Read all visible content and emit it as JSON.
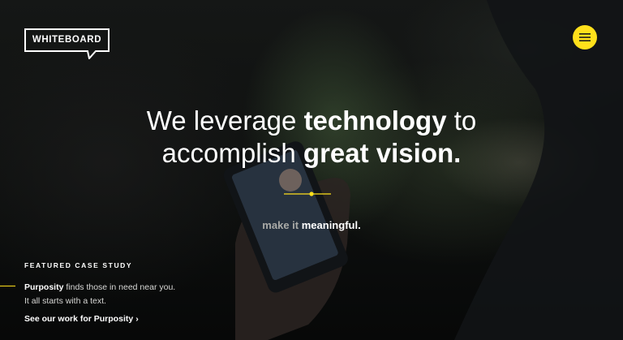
{
  "brand": {
    "logo_text": "WHITEBOARD"
  },
  "menu": {
    "icon": "hamburger-menu-icon",
    "color": "#ffe01b"
  },
  "hero": {
    "headline_line1_a": "We leverage",
    "headline_line1_b": "technology",
    "headline_line1_c": "to",
    "headline_line2_a": "accomplish",
    "headline_line2_b": "great vision.",
    "tagline_a": "make it",
    "tagline_b": "meaningful."
  },
  "featured": {
    "eyebrow": "FEATURED CASE STUDY",
    "client": "Purposity",
    "desc_rest": "finds those in need near you.",
    "desc_line2": "It all starts with a text.",
    "cta_label": "See our work for Purposity",
    "cta_icon": "chevron-right-icon"
  },
  "colors": {
    "accent": "#ffe01b",
    "background": "#0b0c0d",
    "text": "#ffffff"
  }
}
